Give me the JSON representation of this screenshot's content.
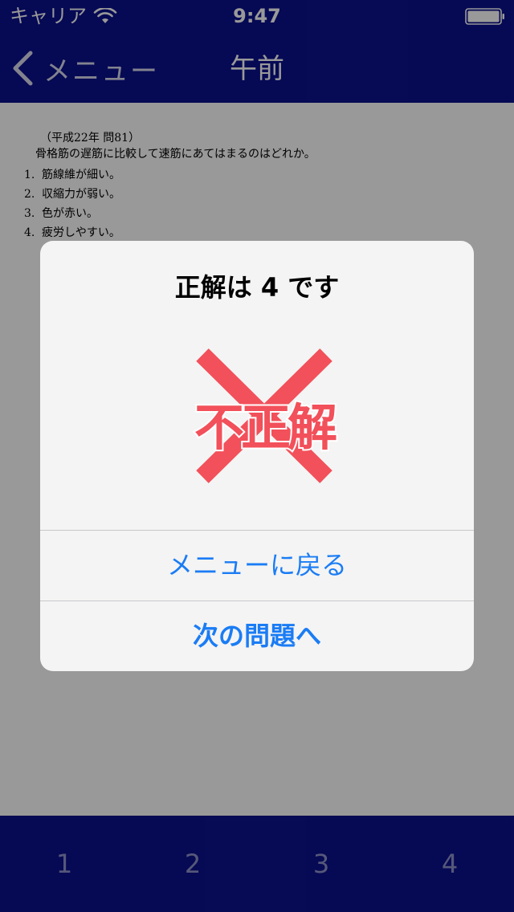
{
  "status_bar": {
    "carrier": "キャリア",
    "time": "9:47"
  },
  "nav": {
    "back_label": "メニュー",
    "title": "午前"
  },
  "question": {
    "year": "（平成22年 問81）",
    "text": "骨格筋の遅筋に比較して速筋にあてはまるのはどれか。",
    "choices": [
      {
        "num": "1.",
        "text": "筋線維が細い。"
      },
      {
        "num": "2.",
        "text": "収縮力が弱い。"
      },
      {
        "num": "3.",
        "text": "色が赤い。"
      },
      {
        "num": "4.",
        "text": "疲労しやすい。"
      }
    ]
  },
  "alert": {
    "title": "正解は 4 です",
    "result_text": "不正解",
    "menu_button": "メニューに戻る",
    "next_button": "次の問題へ"
  },
  "answer_bar": {
    "buttons": [
      "1",
      "2",
      "3",
      "4"
    ]
  },
  "colors": {
    "bar_background": "#0b108c",
    "alert_button": "#1a7cf5",
    "result_red": "#f2505a"
  },
  "icons": {
    "back": "chevron-left-icon",
    "wifi": "wifi-icon",
    "battery": "battery-icon",
    "result": "cross-mark-icon"
  }
}
